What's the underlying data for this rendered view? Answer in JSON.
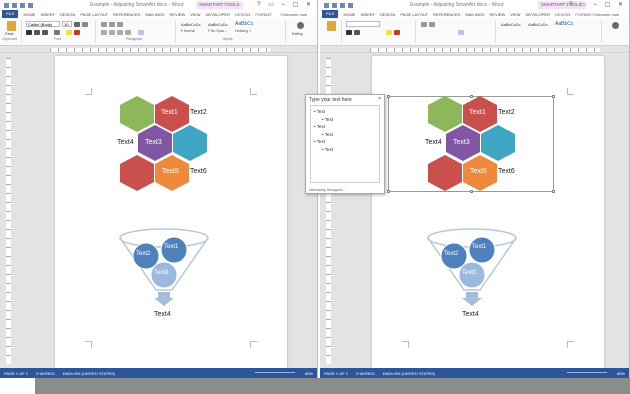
{
  "left_window": {
    "title": "Example - Adjusting SmartArt.docx - Word",
    "contextual_tab_group": "SMARTART TOOLS",
    "tabs": [
      "FILE",
      "HOME",
      "INSERT",
      "DESIGN",
      "PAGE LAYOUT",
      "REFERENCES",
      "MAILINGS",
      "REVIEW",
      "VIEW",
      "DEVELOPER",
      "DESIGN",
      "FORMAT"
    ],
    "user": "Firstname Last",
    "ribbon": {
      "font_name": "Calibri (Body)",
      "font_size": "10",
      "groups": [
        "Clipboard",
        "Font",
        "Paragraph",
        "Styles",
        "Editing"
      ],
      "styles": [
        "AaBbCcDc",
        "AaBbCcDc",
        "AaBbCc"
      ],
      "style_names": [
        "¶ Normal",
        "¶ No Spac...",
        "Heading 1"
      ],
      "paste_label": "Paste",
      "editing_label": "Editing"
    },
    "statusbar": [
      "PAGE 1 OF 1",
      "0 WORDS",
      "ENGLISH (UNITED STATES)"
    ],
    "zoom_pct": "80%"
  },
  "right_window": {
    "title": "Example - Adjusting SmartArt.docx - Word",
    "contextual_tab_group": "SMARTART TOOLS",
    "tabs": [
      "FILE",
      "HOME",
      "INSERT",
      "DESIGN",
      "PAGE LAYOUT",
      "REFERENCES",
      "MAILINGS",
      "REVIEW",
      "VIEW",
      "DEVELOPER",
      "DESIGN",
      "FORMAT"
    ],
    "user": "Firstname Last",
    "statusbar": [
      "PAGE 1 OF 1",
      "0 WORDS",
      "ENGLISH (UNITED STATES)"
    ],
    "zoom_pct": "80%"
  },
  "text_pane": {
    "title": "Type your text here",
    "close": "×",
    "items": [
      {
        "text": "Text",
        "level": 1
      },
      {
        "text": "Text",
        "level": 2
      },
      {
        "text": "Text",
        "level": 1
      },
      {
        "text": "Text",
        "level": 2
      },
      {
        "text": "Text",
        "level": 1
      },
      {
        "text": "Text",
        "level": 2
      }
    ],
    "footer": "Alternating Hexagons..."
  },
  "hexagons": {
    "labels": [
      "Text1",
      "Text2",
      "Text3",
      "Text4",
      "Text5",
      "Text6"
    ],
    "colors": {
      "green": "#8db75a",
      "red": "#c9504d",
      "purple": "#8156a3",
      "teal": "#3fa6c4",
      "orange": "#ef8a3c"
    }
  },
  "funnel": {
    "labels": [
      "Text1",
      "Text2",
      "Text3",
      "Text4"
    ],
    "colors": {
      "blue": "#4f81bd",
      "light": "#9cb8dd"
    }
  }
}
